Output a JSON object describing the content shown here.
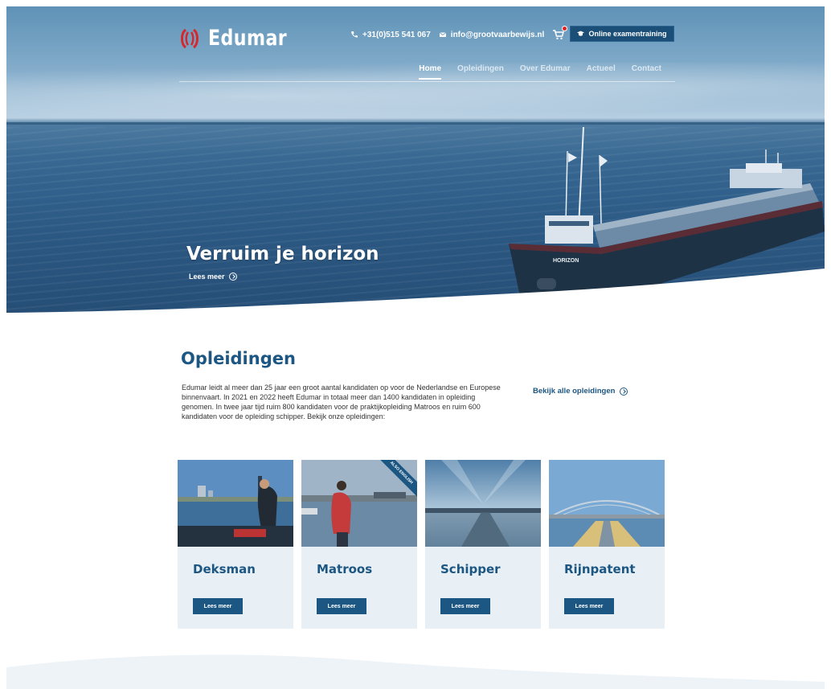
{
  "brand": {
    "name": "Edumar",
    "accent": "#1c5683",
    "logo_red": "#d8262b"
  },
  "topbar": {
    "phone": "+31(0)515 541 067",
    "email": "info@grootvaarbewijs.nl",
    "cta_label": "Online examentraining"
  },
  "nav": {
    "items": [
      "Home",
      "Opleidingen",
      "Over Edumar",
      "Actueel",
      "Contact"
    ],
    "active": "Home"
  },
  "hero": {
    "title": "Verruim je horizon",
    "link_label": "Lees meer",
    "ship_name": "HORIZON"
  },
  "courses": {
    "title": "Opleidingen",
    "intro": "Edumar leidt al meer dan 25 jaar een groot aantal kandidaten op voor de Nederlandse en Europese binnenvaart. In 2021 en 2022 heeft Edumar in totaal meer dan 1400 kandidaten in opleiding genomen. In twee jaar tijd ruim 800 kandidaten voor de praktijkopleiding Matroos en ruim 600 kandidaten voor de opleiding schipper. Bekijk onze opleidingen:",
    "all_link": "Bekijk alle opleidingen",
    "cards": [
      {
        "title": "Deksman",
        "button": "Lees meer"
      },
      {
        "title": "Matroos",
        "button": "Lees meer",
        "ribbon": "ALSO ENGLISH"
      },
      {
        "title": "Schipper",
        "button": "Lees meer"
      },
      {
        "title": "Rijnpatent",
        "button": "Lees meer"
      }
    ]
  }
}
